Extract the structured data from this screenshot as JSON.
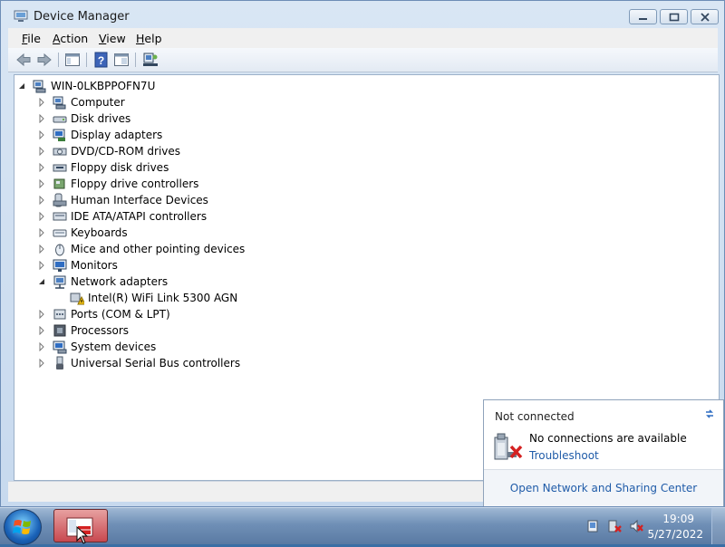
{
  "window": {
    "title": "Device Manager"
  },
  "menubar": {
    "items": [
      {
        "label": "File",
        "accel": "F",
        "rest": "ile"
      },
      {
        "label": "Action",
        "accel": "A",
        "rest": "ction"
      },
      {
        "label": "View",
        "accel": "V",
        "rest": "iew"
      },
      {
        "label": "Help",
        "accel": "H",
        "rest": "elp"
      }
    ]
  },
  "toolbar": {
    "buttons": [
      "back-arrow-icon",
      "forward-arrow-icon",
      "show-hide-console-tree-icon",
      "help-icon",
      "properties-icon",
      "scan-hardware-icon"
    ]
  },
  "tree": {
    "root": "WIN-0LKBPPOFN7U",
    "items": [
      {
        "label": "Computer",
        "icon": "computer-icon"
      },
      {
        "label": "Disk drives",
        "icon": "disk-drive-icon"
      },
      {
        "label": "Display adapters",
        "icon": "display-adapter-icon"
      },
      {
        "label": "DVD/CD-ROM drives",
        "icon": "dvd-drive-icon"
      },
      {
        "label": "Floppy disk drives",
        "icon": "floppy-disk-icon"
      },
      {
        "label": "Floppy drive controllers",
        "icon": "floppy-controller-icon"
      },
      {
        "label": "Human Interface Devices",
        "icon": "hid-icon"
      },
      {
        "label": "IDE ATA/ATAPI controllers",
        "icon": "ide-controller-icon"
      },
      {
        "label": "Keyboards",
        "icon": "keyboard-icon"
      },
      {
        "label": "Mice and other pointing devices",
        "icon": "mouse-icon"
      },
      {
        "label": "Monitors",
        "icon": "monitor-icon"
      },
      {
        "label": "Network adapters",
        "icon": "network-adapter-icon",
        "expanded": true
      },
      {
        "label": "Intel(R)  WiFi Link 5300 AGN",
        "icon": "warning-device-icon",
        "child": true
      },
      {
        "label": "Ports (COM & LPT)",
        "icon": "port-icon"
      },
      {
        "label": "Processors",
        "icon": "processor-icon"
      },
      {
        "label": "System devices",
        "icon": "system-device-icon"
      },
      {
        "label": "Universal Serial Bus controllers",
        "icon": "usb-icon"
      }
    ]
  },
  "popup": {
    "title": "Not connected",
    "message": "No connections are available",
    "troubleshoot_link": "Troubleshoot",
    "network_center_link": "Open Network and Sharing Center"
  },
  "taskbar": {
    "time": "19:09",
    "date": "5/27/2022"
  },
  "colors": {
    "link": "#1f5ba8",
    "taskbar": "#6f8fb6",
    "active_task": "#c8484f"
  }
}
